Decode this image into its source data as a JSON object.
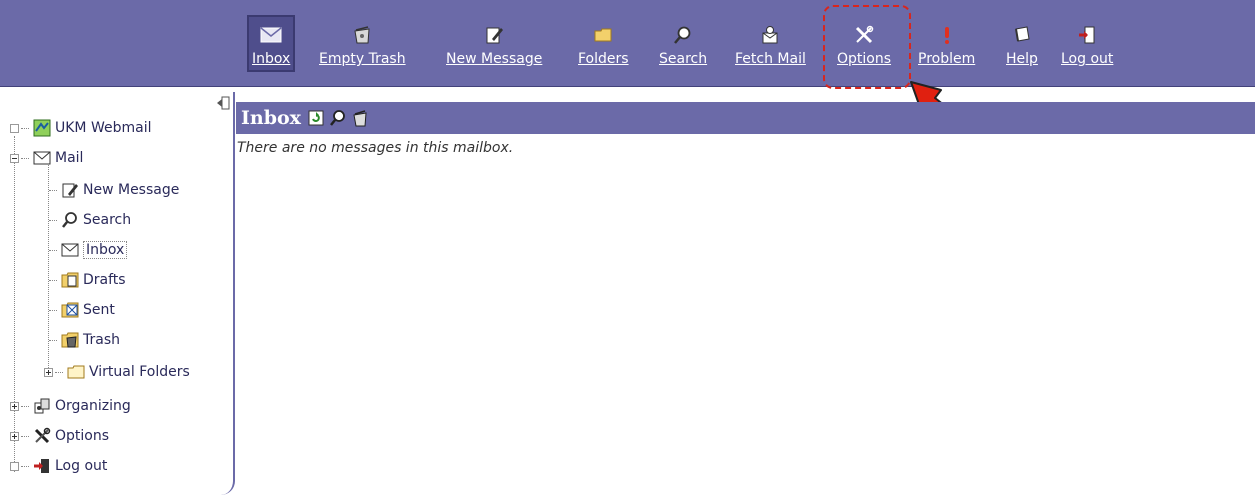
{
  "toolbar": {
    "items": [
      {
        "label": "Inbox",
        "icon": "envelope-icon"
      },
      {
        "label": "Empty Trash",
        "icon": "trash-icon"
      },
      {
        "label": "New Message",
        "icon": "compose-icon"
      },
      {
        "label": "Folders",
        "icon": "folder-icon"
      },
      {
        "label": "Search",
        "icon": "search-icon"
      },
      {
        "label": "Fetch Mail",
        "icon": "fetch-mail-icon"
      },
      {
        "label": "Options",
        "icon": "tools-icon"
      },
      {
        "label": "Problem",
        "icon": "exclamation-icon"
      },
      {
        "label": "Help",
        "icon": "help-book-icon"
      },
      {
        "label": "Log out",
        "icon": "logout-door-icon"
      }
    ],
    "active": "Inbox",
    "highlighted": "Options"
  },
  "sidebar": {
    "root": {
      "label": "UKM Webmail",
      "icon": "map-icon"
    },
    "mail": {
      "label": "Mail",
      "icon": "envelope-icon"
    },
    "mail_items": [
      {
        "label": "New Message",
        "icon": "compose-icon"
      },
      {
        "label": "Search",
        "icon": "search-icon"
      },
      {
        "label": "Inbox",
        "icon": "envelope-icon"
      },
      {
        "label": "Drafts",
        "icon": "drafts-icon"
      },
      {
        "label": "Sent",
        "icon": "sent-icon"
      },
      {
        "label": "Trash",
        "icon": "trash-icon"
      },
      {
        "label": "Virtual Folders",
        "icon": "folder-icon"
      }
    ],
    "bottom_items": [
      {
        "label": "Organizing",
        "icon": "organizing-icon"
      },
      {
        "label": "Options",
        "icon": "tools-icon"
      },
      {
        "label": "Log out",
        "icon": "logout-door-icon"
      }
    ]
  },
  "main": {
    "title": "Inbox",
    "empty_message": "There are no messages in this mailbox."
  },
  "colors": {
    "toolbar_bg": "#6b6aa8",
    "highlight": "#d8261d"
  }
}
